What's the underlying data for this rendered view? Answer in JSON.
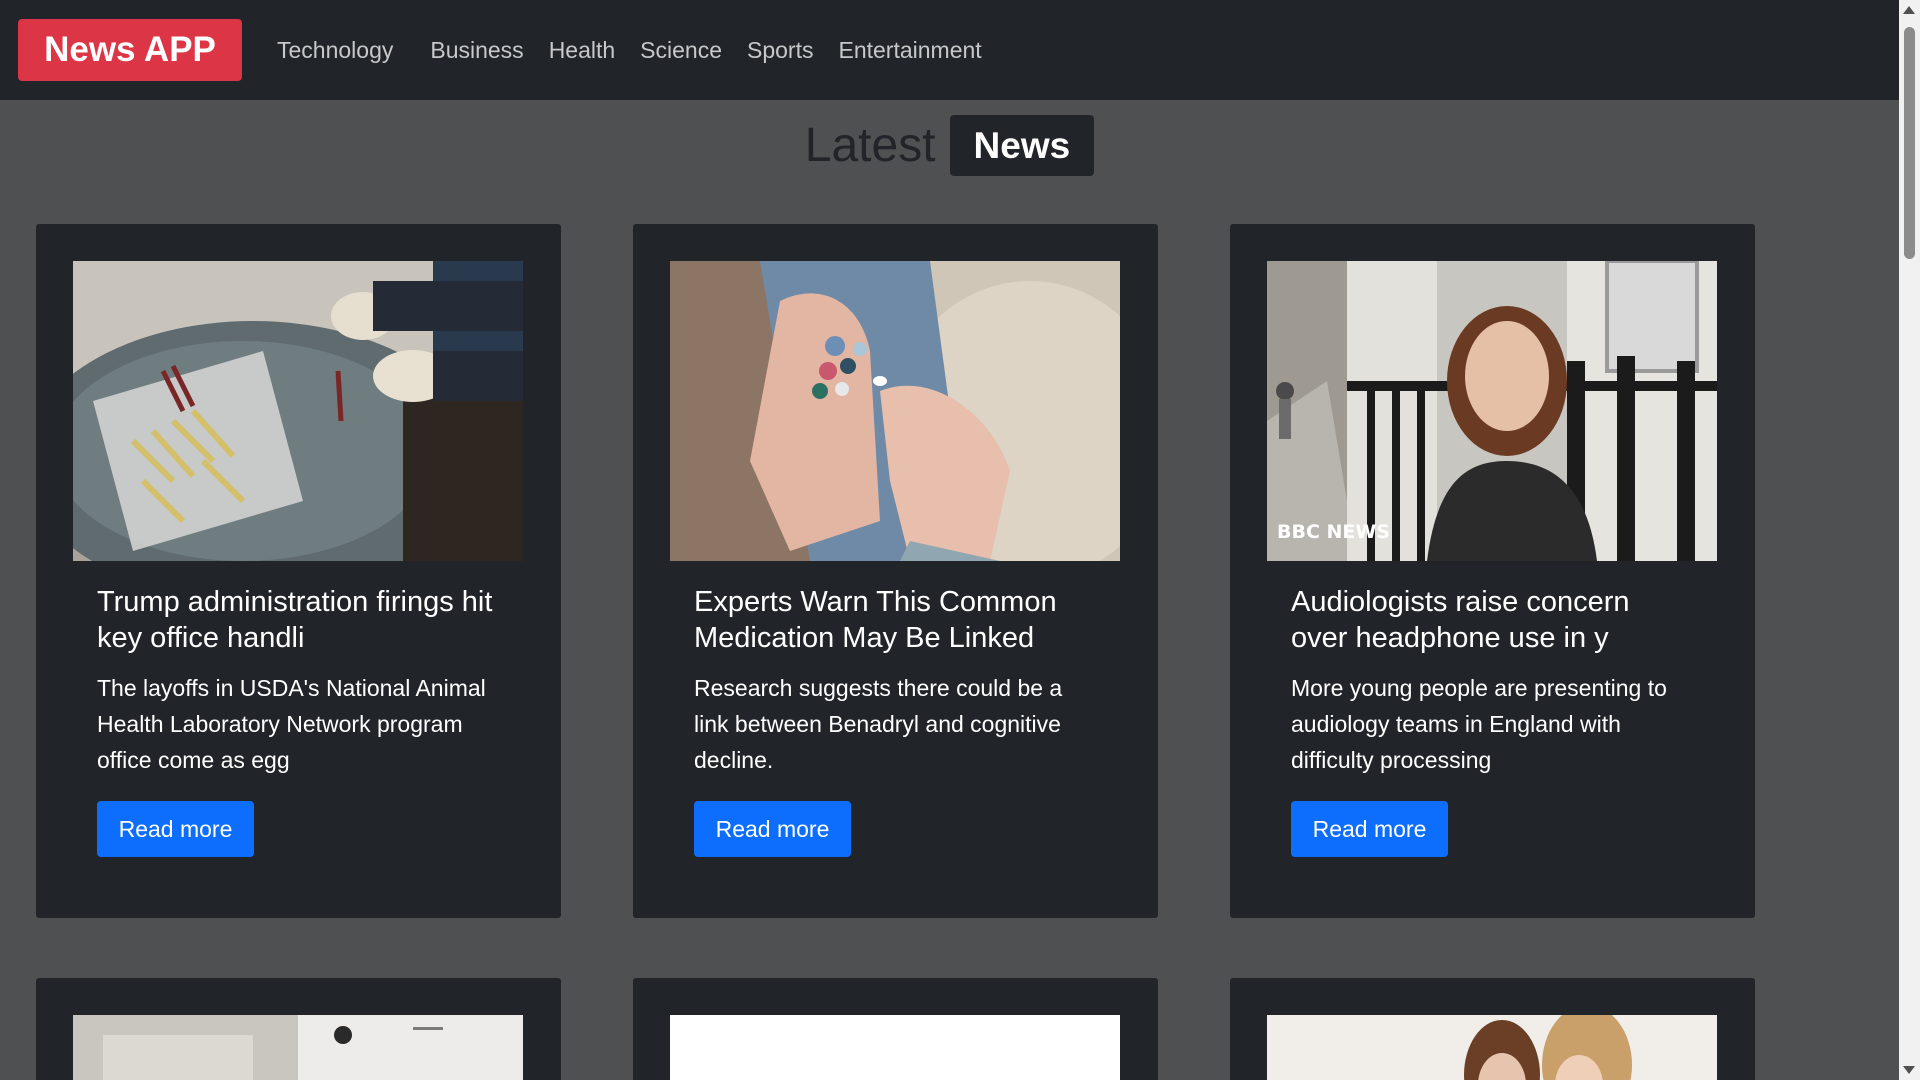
{
  "nav": {
    "brand": "News APP",
    "links": [
      "Technology",
      "Business",
      "Health",
      "Science",
      "Sports",
      "Entertainment"
    ]
  },
  "heading": {
    "prefix": "Latest",
    "badge": "News"
  },
  "articles": [
    {
      "title": "Trump administration firings hit key office handli",
      "description": "The layoffs in USDA's National Animal Health Laboratory Network program office come as egg",
      "button": "Read more",
      "image": "lab-samples-photo"
    },
    {
      "title": "Experts Warn This Common Medication May Be Linked",
      "description": "Research suggests there could be a link between Benadryl and cognitive decline.",
      "button": "Read more",
      "image": "pills-in-hand-photo"
    },
    {
      "title": "Audiologists raise concern over headphone use in y",
      "description": "More young people are presenting to audiology teams in England with difficulty processing",
      "button": "Read more",
      "image": "reporter-street-photo",
      "image_watermark": "BBC NEWS"
    }
  ],
  "more_articles_images": [
    "kitchen-photo",
    "blank-image",
    "two-women-photo"
  ],
  "colors": {
    "navbar": "#212529",
    "brand": "#dc3545",
    "page_bg": "#4f5052",
    "card_bg": "#212529",
    "button": "#0d6efd"
  }
}
